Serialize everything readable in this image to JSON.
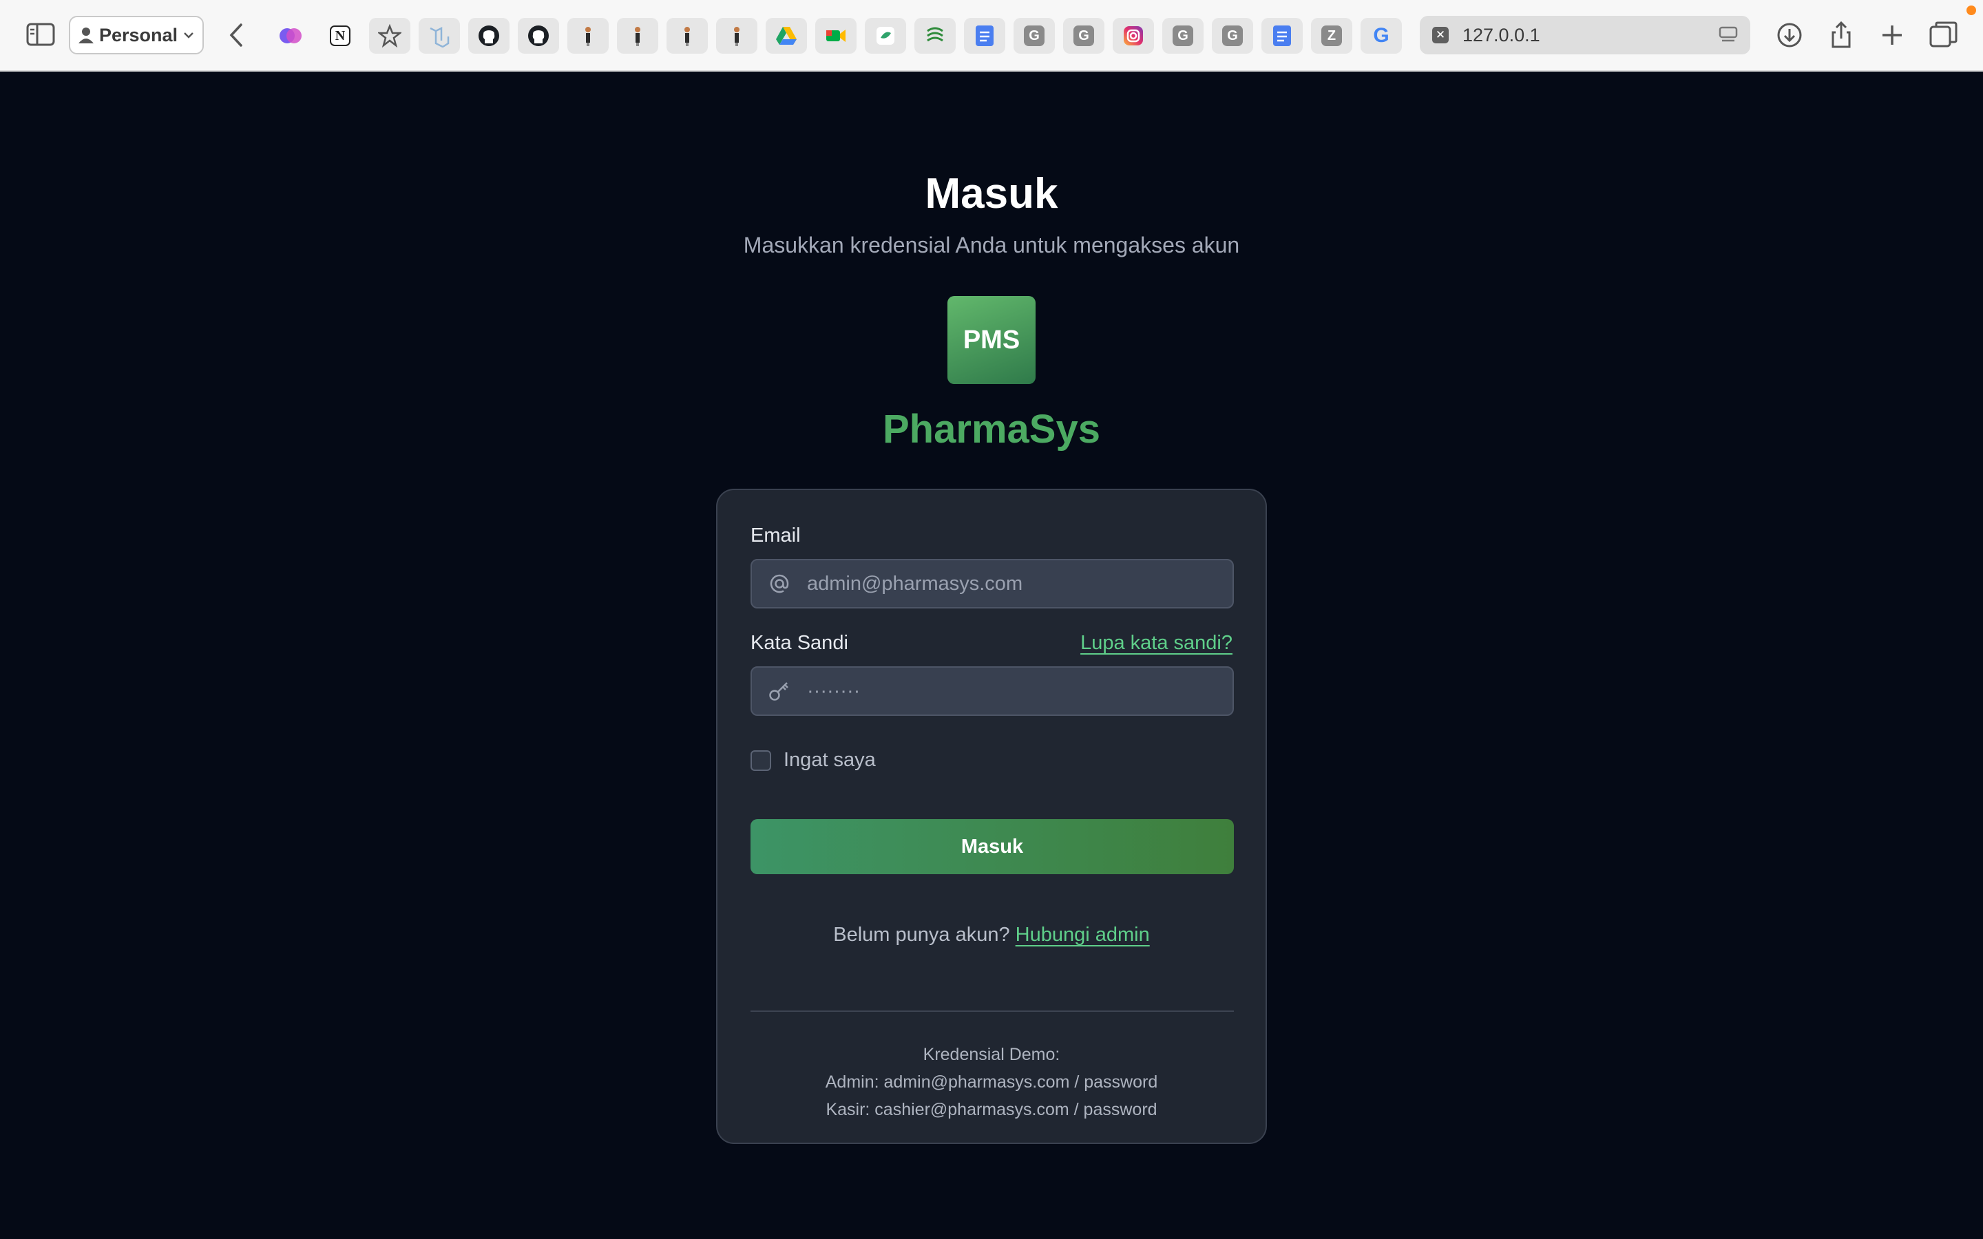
{
  "browser": {
    "profile_label": "Personal",
    "address": "127.0.0.1",
    "bookmarks": [
      {
        "name": "brain-app-icon"
      },
      {
        "name": "notion-icon",
        "letter": "N"
      },
      {
        "name": "star-icon"
      },
      {
        "name": "laravel-icon"
      },
      {
        "name": "github-icon"
      },
      {
        "name": "github-icon"
      },
      {
        "name": "person-bookmark-icon"
      },
      {
        "name": "person-bookmark-icon"
      },
      {
        "name": "person-bookmark-icon"
      },
      {
        "name": "person-bookmark-icon"
      },
      {
        "name": "google-drive-icon"
      },
      {
        "name": "google-meet-icon"
      },
      {
        "name": "leaf-icon"
      },
      {
        "name": "swirl-app-icon"
      },
      {
        "name": "google-docs-icon",
        "color": "#4a7ef0"
      },
      {
        "name": "g-bookmark-icon",
        "letter": "G",
        "color": "#8a8a8a"
      },
      {
        "name": "g-bookmark-icon",
        "letter": "G",
        "color": "#8a8a8a"
      },
      {
        "name": "instagram-icon"
      },
      {
        "name": "g-bookmark-icon",
        "letter": "G",
        "color": "#8a8a8a"
      },
      {
        "name": "g-bookmark-icon",
        "letter": "G",
        "color": "#8a8a8a"
      },
      {
        "name": "google-docs-icon",
        "color": "#4a7ef0"
      },
      {
        "name": "z-bookmark-icon",
        "letter": "Z",
        "color": "#8a8a8a"
      },
      {
        "name": "google-icon",
        "letter": "G"
      }
    ]
  },
  "login": {
    "title": "Masuk",
    "subtitle": "Masukkan kredensial Anda untuk mengakses akun",
    "logo_text": "PMS",
    "brand_name": "PharmaSys",
    "email_label": "Email",
    "email_placeholder": "admin@pharmasys.com",
    "password_label": "Kata Sandi",
    "forgot_link": "Lupa kata sandi?",
    "password_placeholder": "········",
    "remember_label": "Ingat saya",
    "submit_label": "Masuk",
    "signup_prompt": "Belum punya akun?",
    "signup_link": "Hubungi admin",
    "demo_title": "Kredensial Demo:",
    "demo_admin": "Admin: admin@pharmasys.com / password",
    "demo_cashier": "Kasir: cashier@pharmasys.com / password"
  },
  "colors": {
    "page_bg": "#050a16",
    "card_bg": "#202631",
    "brand_green": "#4caa62",
    "link_green": "#5fcf8a"
  }
}
